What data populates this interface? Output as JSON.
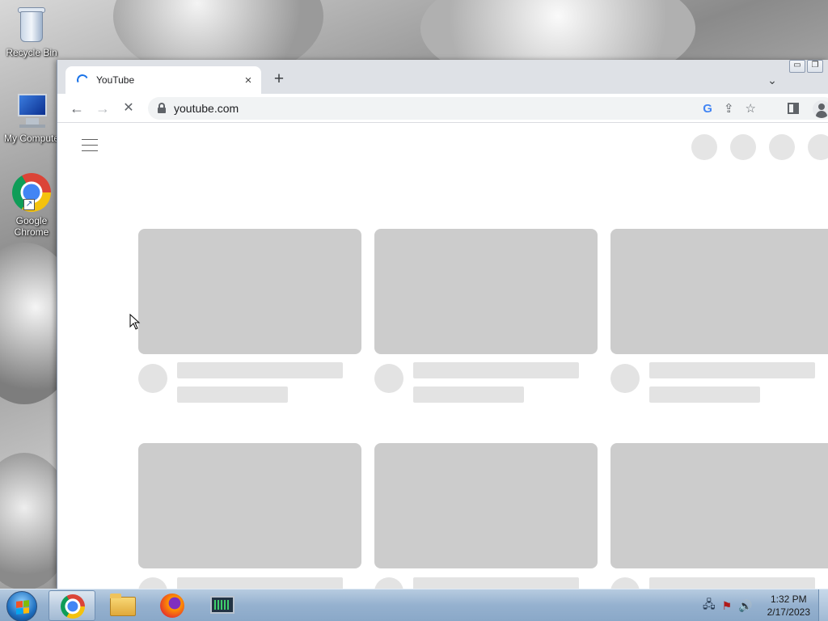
{
  "desktop": {
    "icons": [
      {
        "label": "Recycle Bin",
        "icon": "recycle-bin-icon"
      },
      {
        "label": "My Compute",
        "icon": "computer-icon"
      },
      {
        "label": "Google Chrome",
        "icon": "chrome-icon"
      }
    ]
  },
  "browser": {
    "tab": {
      "title": "YouTube",
      "close": "×"
    },
    "new_tab": "+",
    "tab_menu": "⌄",
    "toolbar": {
      "back": "←",
      "forward": "→",
      "stop": "✕"
    },
    "omnibox": {
      "url": "youtube.com"
    },
    "omnibox_icons": {
      "google": "G",
      "share": "⇪",
      "bookmark": "☆"
    }
  },
  "taskbar": {
    "apps": [
      "Google Chrome",
      "Windows Explorer",
      "Firefox",
      "Task Manager"
    ],
    "clock": {
      "time": "1:32 PM",
      "date": "2/17/2023"
    }
  },
  "colors": {
    "accent": "#1a73e8",
    "skeleton": "#cccccc",
    "skeleton_light": "#e3e3e3"
  }
}
